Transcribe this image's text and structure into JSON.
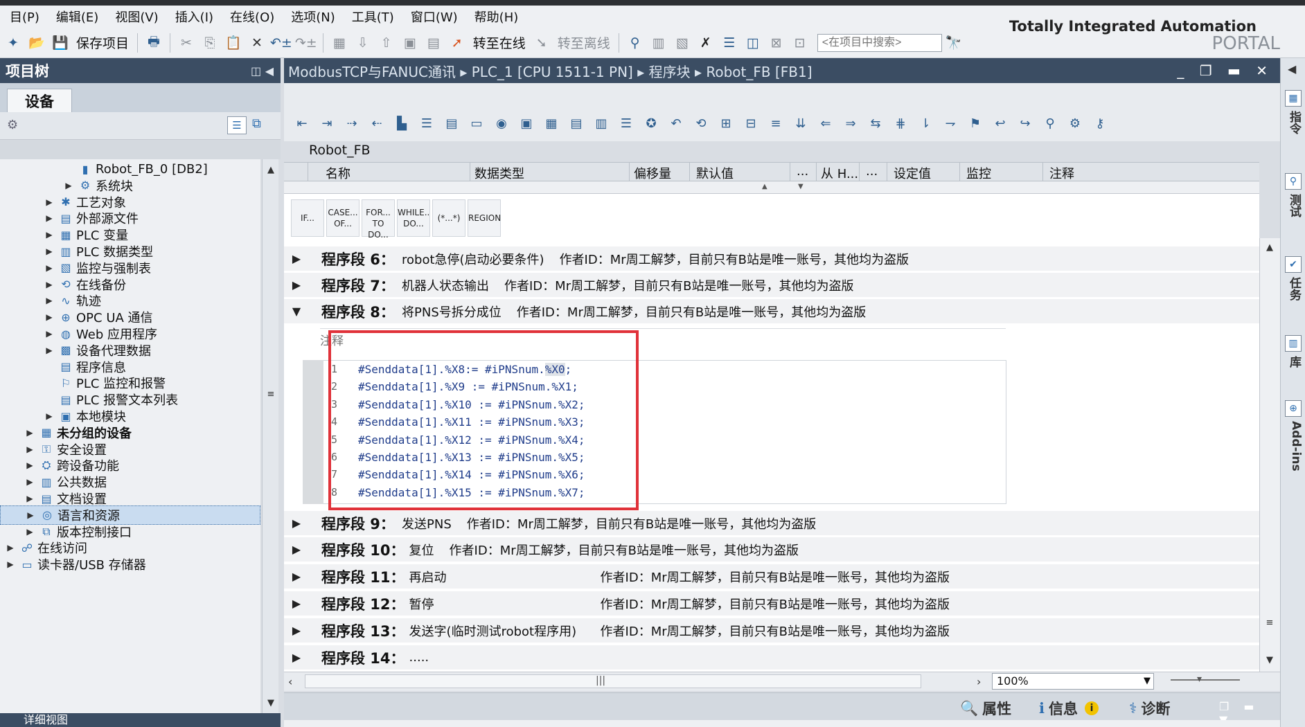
{
  "menu": [
    "目(P)",
    "编辑(E)",
    "视图(V)",
    "插入(I)",
    "在线(O)",
    "选项(N)",
    "工具(T)",
    "窗口(W)",
    "帮助(H)"
  ],
  "toolbar": {
    "save_label": "保存项目",
    "go_online": "转至在线",
    "go_offline": "转至离线",
    "search_placeholder": "<在项目中搜索>"
  },
  "brand": {
    "line1": "Totally Integrated Automation",
    "line2": "PORTAL"
  },
  "project_tree": {
    "title": "项目树",
    "tab": "设备",
    "items": [
      {
        "label": "Robot_FB_0 [DB2]",
        "level": 3,
        "expand": false
      },
      {
        "label": "系统块",
        "level": 3,
        "expand": true
      },
      {
        "label": "工艺对象",
        "level": 2,
        "expand": true
      },
      {
        "label": "外部源文件",
        "level": 2,
        "expand": true
      },
      {
        "label": "PLC 变量",
        "level": 2,
        "expand": true
      },
      {
        "label": "PLC 数据类型",
        "level": 2,
        "expand": true
      },
      {
        "label": "监控与强制表",
        "level": 2,
        "expand": true
      },
      {
        "label": "在线备份",
        "level": 2,
        "expand": true
      },
      {
        "label": "轨迹",
        "level": 2,
        "expand": true
      },
      {
        "label": "OPC UA 通信",
        "level": 2,
        "expand": true
      },
      {
        "label": "Web 应用程序",
        "level": 2,
        "expand": true
      },
      {
        "label": "设备代理数据",
        "level": 2,
        "expand": true
      },
      {
        "label": "程序信息",
        "level": 2,
        "expand": false
      },
      {
        "label": "PLC 监控和报警",
        "level": 2,
        "expand": false
      },
      {
        "label": "PLC 报警文本列表",
        "level": 2,
        "expand": false
      },
      {
        "label": "本地模块",
        "level": 2,
        "expand": true
      },
      {
        "label": "未分组的设备",
        "level": 1,
        "expand": true,
        "bold": true
      },
      {
        "label": "安全设置",
        "level": 1,
        "expand": true
      },
      {
        "label": "跨设备功能",
        "level": 1,
        "expand": true
      },
      {
        "label": "公共数据",
        "level": 1,
        "expand": true
      },
      {
        "label": "文档设置",
        "level": 1,
        "expand": true
      },
      {
        "label": "语言和资源",
        "level": 1,
        "expand": true,
        "selected": true
      },
      {
        "label": "版本控制接口",
        "level": 1,
        "expand": true
      },
      {
        "label": "在线访问",
        "level": 0,
        "expand": true
      },
      {
        "label": "读卡器/USB 存储器",
        "level": 0,
        "expand": true
      }
    ],
    "detail_view": "详细视图"
  },
  "editor": {
    "breadcrumb": [
      "ModbusTCP与FANUC通讯",
      "PLC_1 [CPU 1511-1 PN]",
      "程序块",
      "Robot_FB [FB1]"
    ],
    "block_name": "Robot_FB",
    "columns": [
      "名称",
      "数据类型",
      "偏移量",
      "默认值",
      "...",
      "从 H...",
      "...",
      "设定值",
      "监控",
      "注释"
    ],
    "instructions": [
      {
        "l1": "IF...",
        "l2": ""
      },
      {
        "l1": "CASE...",
        "l2": "OF..."
      },
      {
        "l1": "FOR...",
        "l2": "TO DO..."
      },
      {
        "l1": "WHILE..",
        "l2": "DO..."
      },
      {
        "l1": "(*...*)",
        "l2": ""
      },
      {
        "l1": "REGION",
        "l2": ""
      }
    ],
    "networks": [
      {
        "title": "程序段 6：",
        "desc": "robot急停(启动必要条件)",
        "author": "作者ID：Mr周工解梦，目前只有B站是唯一账号，其他均为盗版",
        "expanded": false
      },
      {
        "title": "程序段 7：",
        "desc": "机器人状态输出",
        "author": "作者ID：Mr周工解梦，目前只有B站是唯一账号，其他均为盗版",
        "expanded": false
      },
      {
        "title": "程序段 8：",
        "desc": "将PNS号拆分成位",
        "author": "作者ID：Mr周工解梦，目前只有B站是唯一账号，其他均为盗版",
        "expanded": true
      },
      {
        "title": "程序段 9：",
        "desc": "发送PNS",
        "author": "作者ID：Mr周工解梦，目前只有B站是唯一账号，其他均为盗版",
        "expanded": false
      },
      {
        "title": "程序段 10：",
        "desc": "复位",
        "author": "作者ID：Mr周工解梦，目前只有B站是唯一账号，其他均为盗版",
        "expanded": false
      },
      {
        "title": "程序段 11：",
        "desc": "再启动",
        "author": "作者ID：Mr周工解梦，目前只有B站是唯一账号，其他均为盗版",
        "expanded": false
      },
      {
        "title": "程序段 12：",
        "desc": "暂停",
        "author": "作者ID：Mr周工解梦，目前只有B站是唯一账号，其他均为盗版",
        "expanded": false
      },
      {
        "title": "程序段 13：",
        "desc": "发送字(临时测试robot程序用)",
        "author": "作者ID：Mr周工解梦，目前只有B站是唯一账号，其他均为盗版",
        "expanded": false
      },
      {
        "title": "程序段 14：",
        "desc": ".....",
        "author": "",
        "expanded": false
      }
    ],
    "comment_placeholder": "注释",
    "code": [
      {
        "n": "1",
        "pre": "#Senddata[1].%X8:= #iPNSnum.",
        "hl": "%X0",
        "post": ";"
      },
      {
        "n": "2",
        "pre": "#Senddata[1].%X9 := #iPNSnum.%X1;",
        "hl": "",
        "post": ""
      },
      {
        "n": "3",
        "pre": "#Senddata[1].%X10 := #iPNSnum.%X2;",
        "hl": "",
        "post": ""
      },
      {
        "n": "4",
        "pre": "#Senddata[1].%X11 := #iPNSnum.%X3;",
        "hl": "",
        "post": ""
      },
      {
        "n": "5",
        "pre": "#Senddata[1].%X12 := #iPNSnum.%X4;",
        "hl": "",
        "post": ""
      },
      {
        "n": "6",
        "pre": "#Senddata[1].%X13 := #iPNSnum.%X5;",
        "hl": "",
        "post": ""
      },
      {
        "n": "7",
        "pre": "#Senddata[1].%X14 := #iPNSnum.%X6;",
        "hl": "",
        "post": ""
      },
      {
        "n": "8",
        "pre": "#Senddata[1].%X15 := #iPNSnum.%X7;",
        "hl": "",
        "post": ""
      }
    ],
    "zoom": "100%"
  },
  "right_tabs": [
    "指令",
    "测试",
    "任务",
    "库",
    "Add-ins"
  ],
  "status_tabs": [
    "属性",
    "信息",
    "诊断"
  ],
  "colors": {
    "header": "#3b4d63",
    "highlight_box": "#e0323a",
    "code": "#1f3c8a"
  }
}
